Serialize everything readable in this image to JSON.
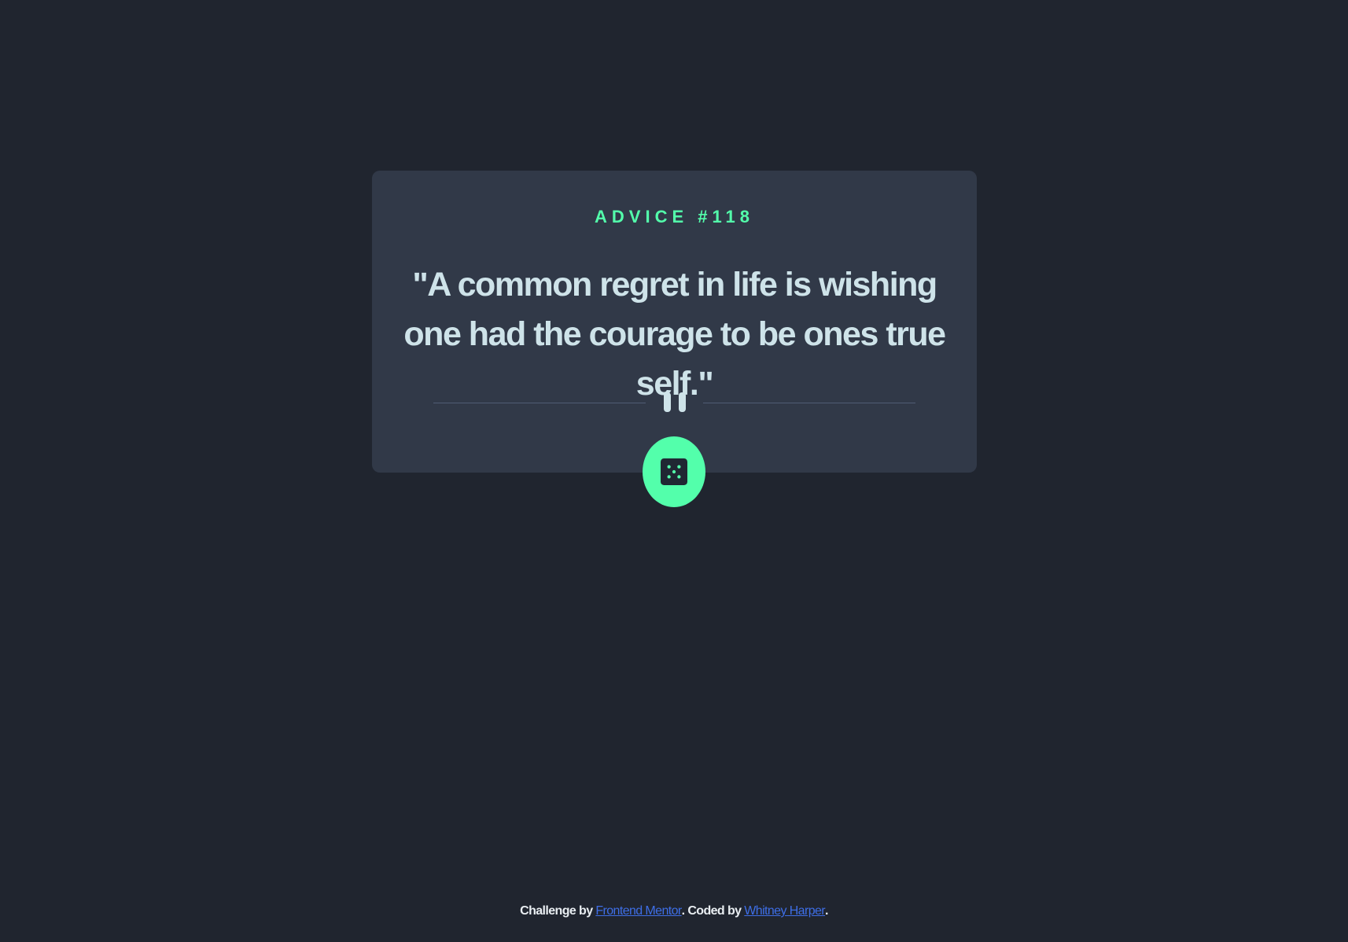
{
  "card": {
    "advice_label": "ADVICE #118",
    "quote": "\"A common regret in life is wishing one had the courage to be ones true self.\""
  },
  "icons": {
    "divider": "pause-icon",
    "button": "dice-icon"
  },
  "footer": {
    "prefix": "Challenge by ",
    "challenge_link": "Frontend Mentor",
    "middle": ". Coded by ",
    "author_link": "Whitney Harper",
    "suffix": "."
  },
  "colors": {
    "background": "#20252f",
    "card": "#313948",
    "accent": "#53ffab",
    "text": "#cee3e9",
    "link": "#3e6ee6"
  }
}
